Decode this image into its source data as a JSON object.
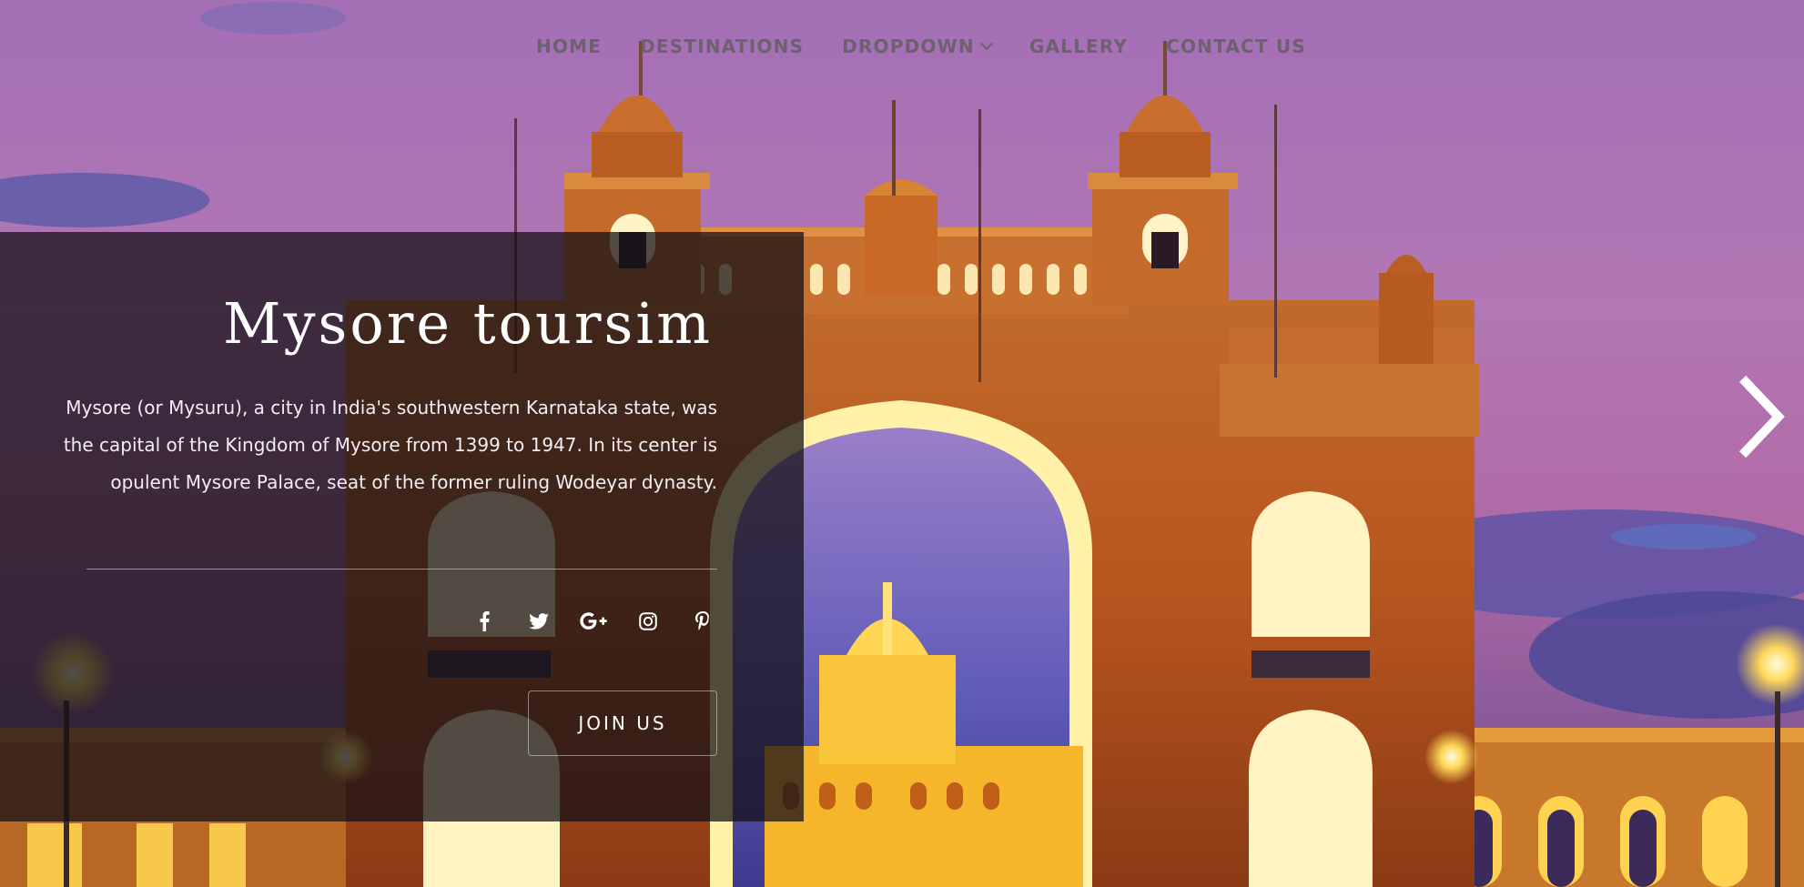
{
  "nav": {
    "items": [
      {
        "label": "HOME"
      },
      {
        "label": "DESTINATIONS"
      },
      {
        "label": "DROPDOWN",
        "has_submenu": true
      },
      {
        "label": "GALLERY"
      },
      {
        "label": "CONTACT US"
      }
    ]
  },
  "hero": {
    "title": "Mysore toursim",
    "description": "Mysore (or Mysuru), a city in India's southwestern Karnataka state, was the capital of the Kingdom of Mysore from 1399 to 1947. In its center is opulent Mysore Palace, seat of the former ruling Wodeyar dynasty.",
    "social_icons": [
      "facebook-icon",
      "twitter-icon",
      "google-plus-icon",
      "instagram-icon",
      "pinterest-icon"
    ],
    "cta_label": "JOIN US"
  },
  "slider": {
    "next_icon": "chevron-right-icon"
  },
  "colors": {
    "nav_text": "#6d6170",
    "overlay": "#141016",
    "text": "#ffffff",
    "palace_glow": "#f5a623"
  }
}
